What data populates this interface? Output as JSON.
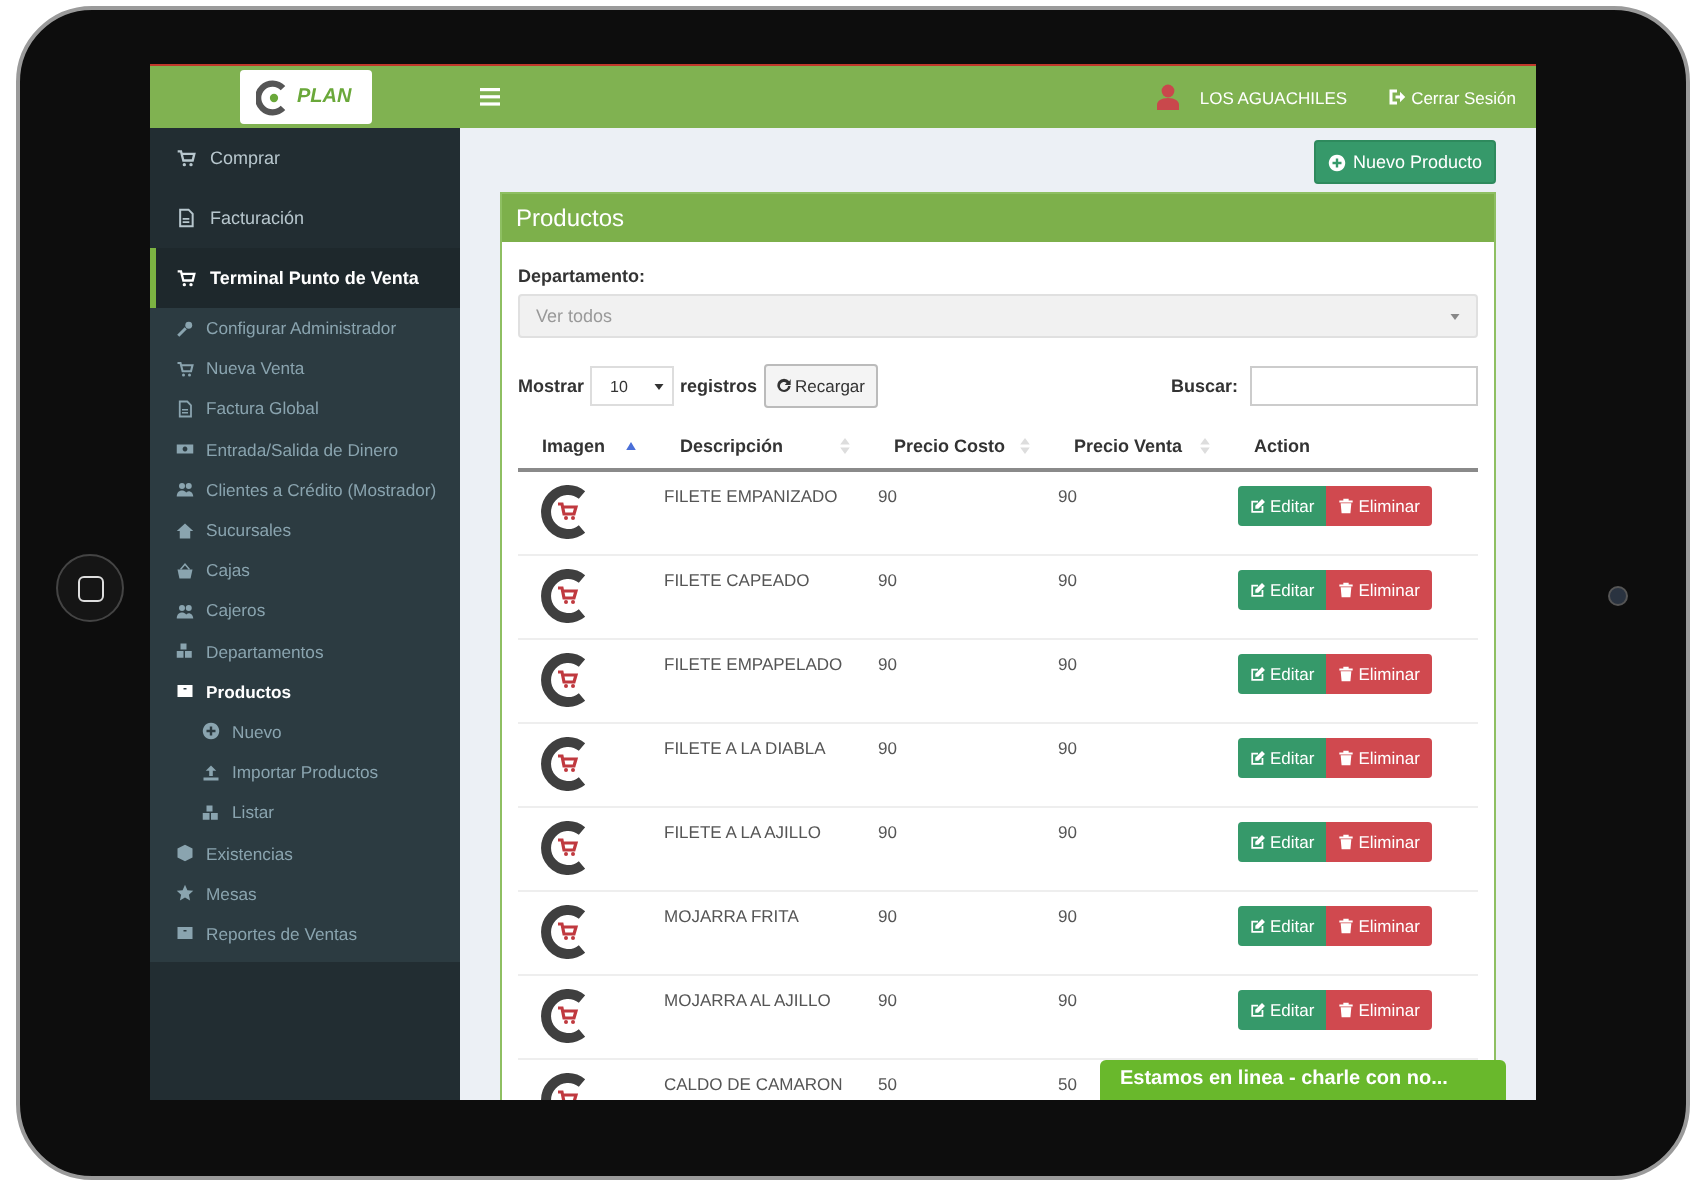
{
  "header": {
    "logo_text": "PLAN",
    "user_name": "LOS AGUACHILES",
    "logout": "Cerrar Sesión"
  },
  "sidebar": {
    "items": [
      {
        "label": "Comprar",
        "selected": false
      },
      {
        "label": "Facturación",
        "selected": false
      },
      {
        "label": "Terminal Punto de Venta",
        "selected": true,
        "children": [
          {
            "label": "Configurar Administrador",
            "selected": false
          },
          {
            "label": "Nueva Venta",
            "selected": false
          },
          {
            "label": "Factura Global",
            "selected": false
          },
          {
            "label": "Entrada/Salida de Dinero",
            "selected": false
          },
          {
            "label": "Clientes a Crédito (Mostrador)",
            "selected": false
          },
          {
            "label": "Sucursales",
            "selected": false
          },
          {
            "label": "Cajas",
            "selected": false
          },
          {
            "label": "Cajeros",
            "selected": false
          },
          {
            "label": "Departamentos",
            "selected": false
          },
          {
            "label": "Productos",
            "selected": true,
            "children": [
              {
                "label": "Nuevo",
                "selected": false
              },
              {
                "label": "Importar Productos",
                "selected": false
              },
              {
                "label": "Listar",
                "selected": false
              }
            ]
          },
          {
            "label": "Existencias",
            "selected": false
          },
          {
            "label": "Mesas",
            "selected": false
          },
          {
            "label": "Reportes de Ventas",
            "selected": false
          }
        ]
      }
    ]
  },
  "toolbar": {
    "new_button": "Nuevo Producto"
  },
  "panel": {
    "title": "Productos",
    "department_label": "Departamento:",
    "department_value": "Ver todos",
    "show_label": "Mostrar",
    "page_size": "10",
    "records_label": "registros",
    "reload_button": "Recargar",
    "search_label": "Buscar:"
  },
  "table": {
    "columns": [
      {
        "label": "Imagen",
        "sortable": true,
        "sorted_ascending": true
      },
      {
        "label": "Descripción",
        "sortable": true,
        "sorted_ascending": false
      },
      {
        "label": "Precio Costo",
        "sortable": true,
        "sorted_ascending": false
      },
      {
        "label": "Precio Venta",
        "sortable": true,
        "sorted_ascending": false
      },
      {
        "label": "Action",
        "sortable": false,
        "sorted_ascending": false
      }
    ],
    "rows": [
      {
        "description": "FILETE EMPANIZADO",
        "cost": "90",
        "price": "90",
        "actions": [
          {
            "label": "Editar",
            "kind": "edit"
          },
          {
            "label": "Eliminar",
            "kind": "delete"
          }
        ]
      },
      {
        "description": "FILETE CAPEADO",
        "cost": "90",
        "price": "90",
        "actions": [
          {
            "label": "Editar",
            "kind": "edit"
          },
          {
            "label": "Eliminar",
            "kind": "delete"
          }
        ]
      },
      {
        "description": "FILETE EMPAPELADO",
        "cost": "90",
        "price": "90",
        "actions": [
          {
            "label": "Editar",
            "kind": "edit"
          },
          {
            "label": "Eliminar",
            "kind": "delete"
          }
        ]
      },
      {
        "description": "FILETE A LA DIABLA",
        "cost": "90",
        "price": "90",
        "actions": [
          {
            "label": "Editar",
            "kind": "edit"
          },
          {
            "label": "Eliminar",
            "kind": "delete"
          }
        ]
      },
      {
        "description": "FILETE A LA AJILLO",
        "cost": "90",
        "price": "90",
        "actions": [
          {
            "label": "Editar",
            "kind": "edit"
          },
          {
            "label": "Eliminar",
            "kind": "delete"
          }
        ]
      },
      {
        "description": "MOJARRA FRITA",
        "cost": "90",
        "price": "90",
        "actions": [
          {
            "label": "Editar",
            "kind": "edit"
          },
          {
            "label": "Eliminar",
            "kind": "delete"
          }
        ]
      },
      {
        "description": "MOJARRA AL AJILLO",
        "cost": "90",
        "price": "90",
        "actions": [
          {
            "label": "Editar",
            "kind": "edit"
          },
          {
            "label": "Eliminar",
            "kind": "delete"
          }
        ]
      },
      {
        "description": "CALDO DE CAMARON",
        "cost": "50",
        "price": "50"
      }
    ]
  },
  "chat": {
    "label": "Estamos en linea - charle con no..."
  }
}
